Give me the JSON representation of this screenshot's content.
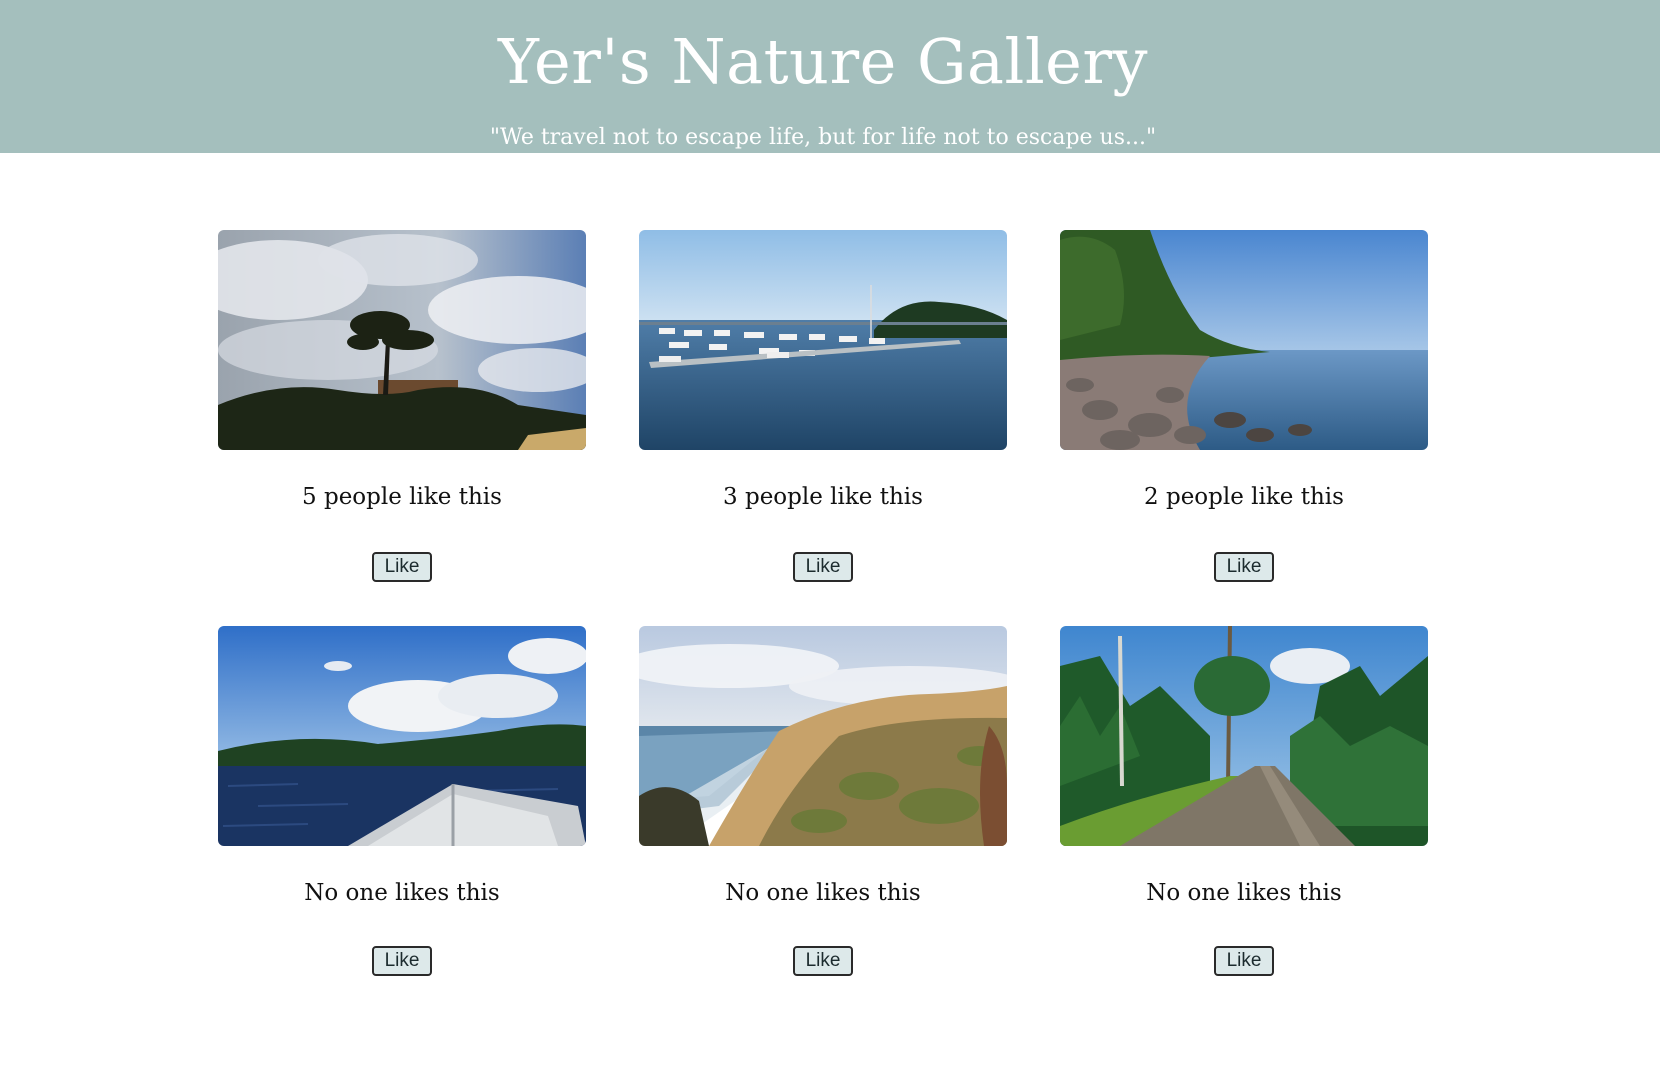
{
  "header": {
    "title": "Yer's Nature Gallery",
    "subtitle": "\"We travel not to escape life, but for life not to escape us...\""
  },
  "colors": {
    "header_bg": "#a4bfbd",
    "button_bg": "#dde9ea"
  },
  "gallery": {
    "items": [
      {
        "photo": "tree-on-cliff-photo",
        "likes_text": "5 people like this",
        "like_label": "Like"
      },
      {
        "photo": "marina-photo",
        "likes_text": "3 people like this",
        "like_label": "Like"
      },
      {
        "photo": "rocky-shore-photo",
        "likes_text": "2 people like this",
        "like_label": "Like"
      },
      {
        "photo": "lake-boat-bow-photo",
        "likes_text": "No one likes this",
        "like_label": "Like"
      },
      {
        "photo": "coastal-bluff-photo",
        "likes_text": "No one likes this",
        "like_label": "Like"
      },
      {
        "photo": "forest-road-photo",
        "likes_text": "No one likes this",
        "like_label": "Like"
      }
    ]
  }
}
